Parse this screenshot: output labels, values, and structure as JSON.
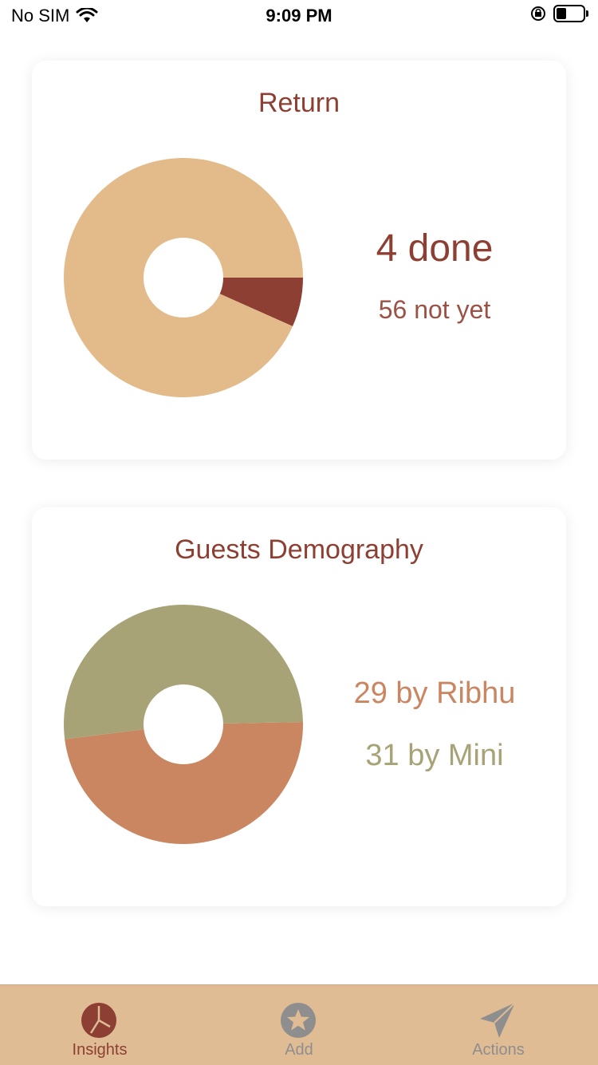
{
  "status_bar": {
    "carrier": "No SIM",
    "time": "9:09 PM"
  },
  "cards": [
    {
      "title": "Return",
      "primary": "4 done",
      "secondary": "56 not yet"
    },
    {
      "title": "Guests Demography",
      "primary": "29 by Ribhu",
      "secondary": "31 by Mini"
    }
  ],
  "tabs": [
    {
      "label": "Insights",
      "icon": "pie-chart-icon",
      "active": true
    },
    {
      "label": "Add",
      "icon": "star-icon",
      "active": false
    },
    {
      "label": "Actions",
      "icon": "send-icon",
      "active": false
    }
  ],
  "chart_data": [
    {
      "type": "pie",
      "title": "Return",
      "slices": [
        {
          "label": "done",
          "value": 4,
          "color": "#8c3f32"
        },
        {
          "label": "not yet",
          "value": 56,
          "color": "#e3bb8a"
        }
      ]
    },
    {
      "type": "pie",
      "title": "Guests Demography",
      "slices": [
        {
          "label": "by Ribhu",
          "value": 29,
          "color": "#c98660"
        },
        {
          "label": "by Mini",
          "value": 31,
          "color": "#a7a377"
        }
      ]
    }
  ],
  "colors": {
    "accent": "#8c3f32",
    "tab_bar": "#e0bc94",
    "inactive": "#8e8e8e"
  }
}
